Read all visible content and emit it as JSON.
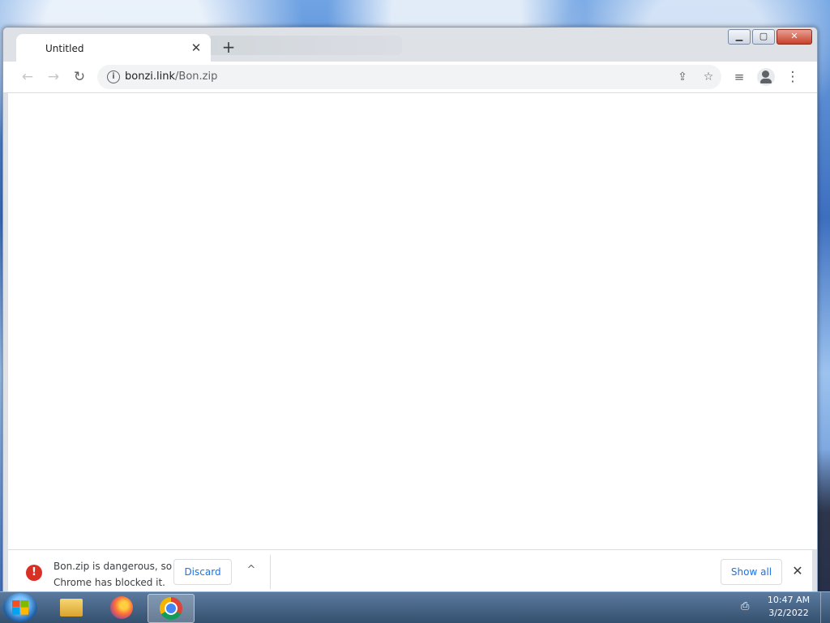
{
  "tab": {
    "title": "Untitled",
    "close": "✕"
  },
  "new_tab": "+",
  "window_controls": {
    "minimize": "▁",
    "maximize": "▢",
    "close": "✕"
  },
  "nav": {
    "back": "←",
    "forward": "→",
    "reload": "↻"
  },
  "omnibox": {
    "host": "bonzi.link",
    "path": "/Bon.zip",
    "info": "i"
  },
  "toolbar_icons": {
    "share": "⇪",
    "bookmark": "☆",
    "reading_list": "≡",
    "menu": "⋮"
  },
  "download_bar": {
    "warning_icon": "!",
    "message": "Bon.zip is dangerous, so Chrome has blocked it.",
    "discard_label": "Discard",
    "chevron": "^",
    "show_all_label": "Show all",
    "close": "✕"
  },
  "taskbar": {
    "apps": [
      "explorer-icon",
      "firefox-icon",
      "chrome-icon"
    ],
    "tray_icon": "⎙",
    "time": "10:47 AM",
    "date": "3/2/2022"
  },
  "colors": {
    "accent": "#1a73e8",
    "danger": "#d93025",
    "chrome_frame": "#dee1e6"
  }
}
